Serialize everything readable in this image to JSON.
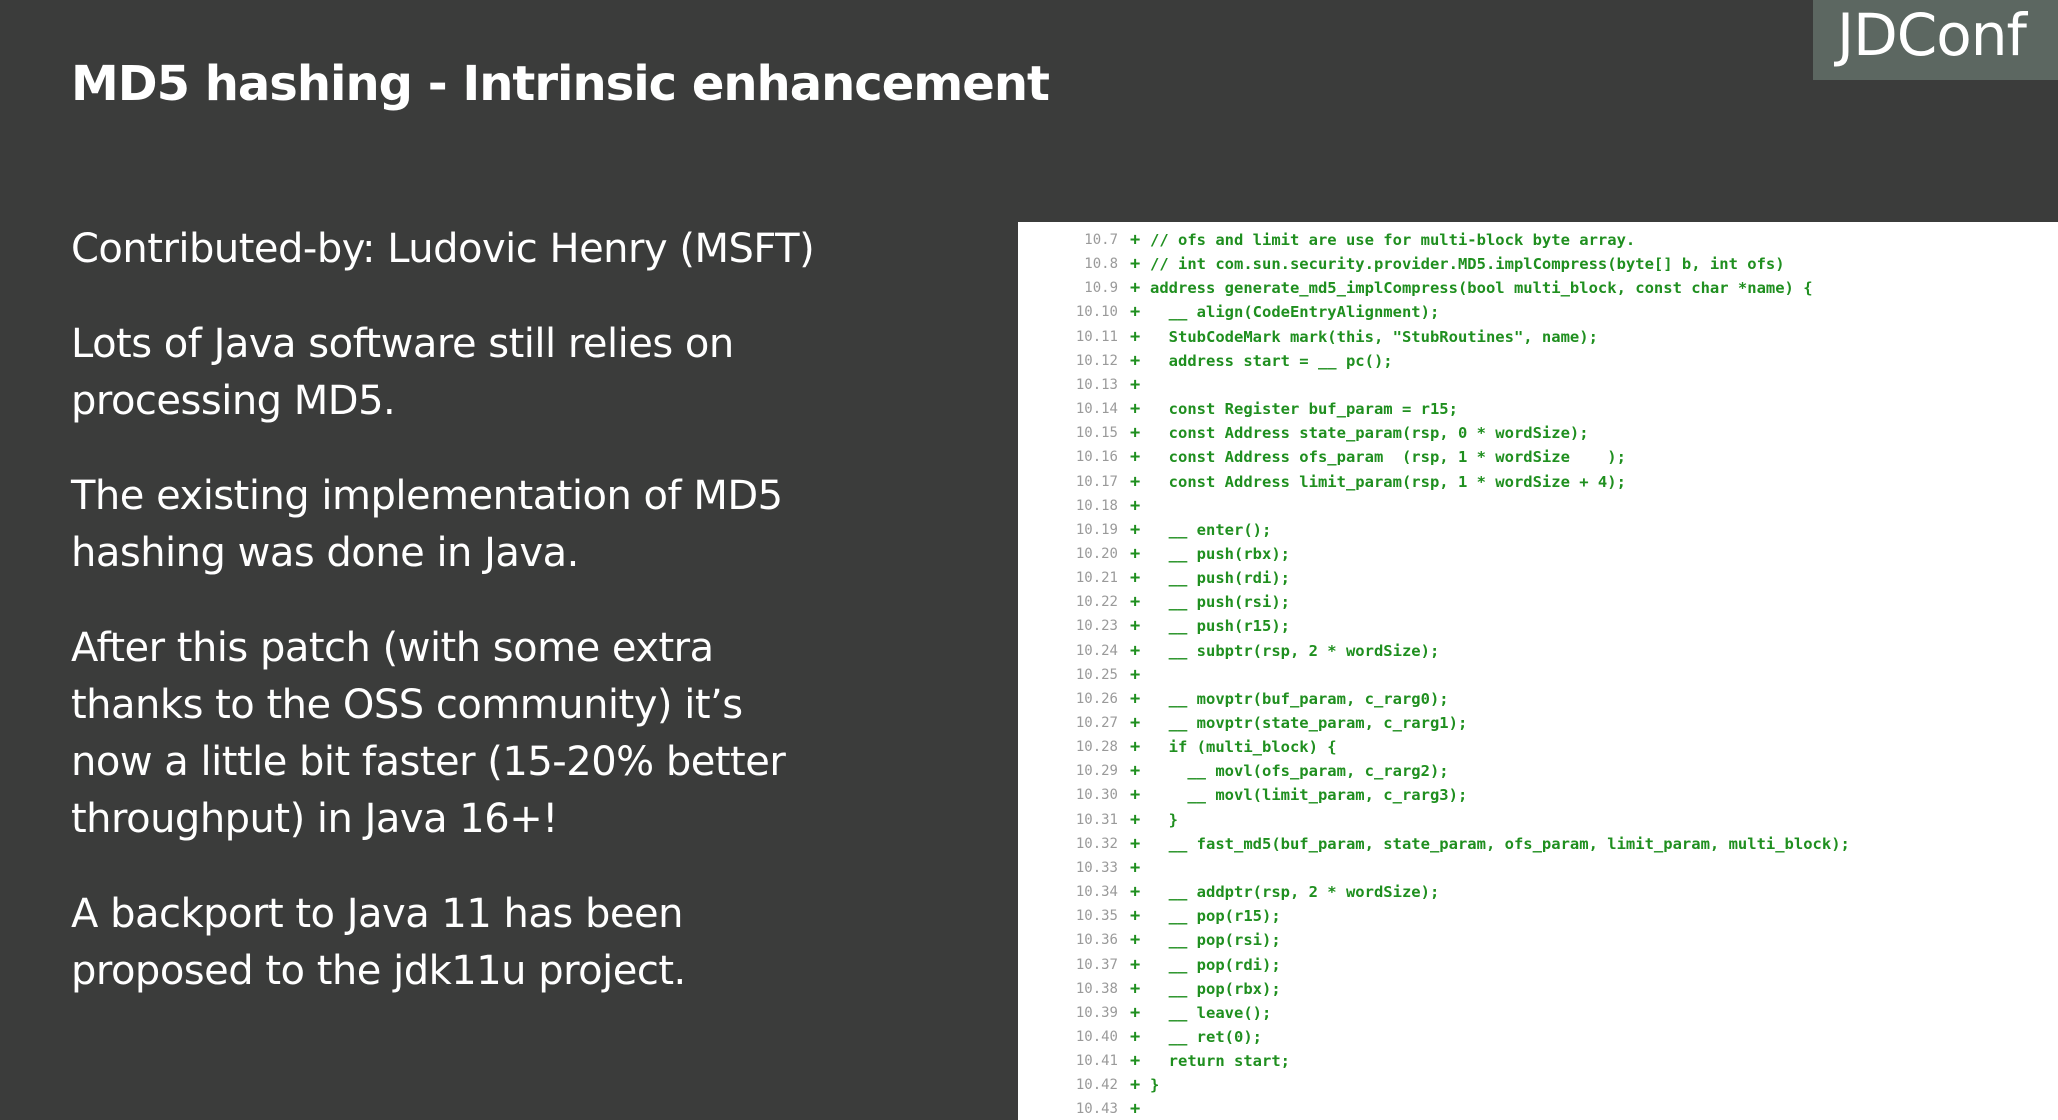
{
  "slide": {
    "title": "MD5 hashing - Intrinsic enhancement",
    "logo": "JDConf",
    "bullets": [
      "Contributed-by: Ludovic Henry (MSFT)",
      "Lots of Java software still relies on\nprocessing MD5.",
      "The existing implementation of MD5\nhashing was done in Java.",
      "After this patch (with some extra\nthanks to the OSS community) it’s\nnow a little bit faster (15-20% better\nthroughput) in Java 16+!",
      "A backport to Java 11 has been\nproposed to the jdk11u project."
    ]
  },
  "code": {
    "lines": [
      {
        "ln": "10.7",
        "mark": "+",
        "text": "// ofs and limit are use for multi-block byte array."
      },
      {
        "ln": "10.8",
        "mark": "+",
        "text": "// int com.sun.security.provider.MD5.implCompress(byte[] b, int ofs)"
      },
      {
        "ln": "10.9",
        "mark": "+",
        "text": "address generate_md5_implCompress(bool multi_block, const char *name) {"
      },
      {
        "ln": "10.10",
        "mark": "+",
        "text": "  __ align(CodeEntryAlignment);"
      },
      {
        "ln": "10.11",
        "mark": "+",
        "text": "  StubCodeMark mark(this, \"StubRoutines\", name);"
      },
      {
        "ln": "10.12",
        "mark": "+",
        "text": "  address start = __ pc();"
      },
      {
        "ln": "10.13",
        "mark": "+",
        "text": ""
      },
      {
        "ln": "10.14",
        "mark": "+",
        "text": "  const Register buf_param = r15;"
      },
      {
        "ln": "10.15",
        "mark": "+",
        "text": "  const Address state_param(rsp, 0 * wordSize);"
      },
      {
        "ln": "10.16",
        "mark": "+",
        "text": "  const Address ofs_param  (rsp, 1 * wordSize    );"
      },
      {
        "ln": "10.17",
        "mark": "+",
        "text": "  const Address limit_param(rsp, 1 * wordSize + 4);"
      },
      {
        "ln": "10.18",
        "mark": "+",
        "text": ""
      },
      {
        "ln": "10.19",
        "mark": "+",
        "text": "  __ enter();"
      },
      {
        "ln": "10.20",
        "mark": "+",
        "text": "  __ push(rbx);"
      },
      {
        "ln": "10.21",
        "mark": "+",
        "text": "  __ push(rdi);"
      },
      {
        "ln": "10.22",
        "mark": "+",
        "text": "  __ push(rsi);"
      },
      {
        "ln": "10.23",
        "mark": "+",
        "text": "  __ push(r15);"
      },
      {
        "ln": "10.24",
        "mark": "+",
        "text": "  __ subptr(rsp, 2 * wordSize);"
      },
      {
        "ln": "10.25",
        "mark": "+",
        "text": ""
      },
      {
        "ln": "10.26",
        "mark": "+",
        "text": "  __ movptr(buf_param, c_rarg0);"
      },
      {
        "ln": "10.27",
        "mark": "+",
        "text": "  __ movptr(state_param, c_rarg1);"
      },
      {
        "ln": "10.28",
        "mark": "+",
        "text": "  if (multi_block) {"
      },
      {
        "ln": "10.29",
        "mark": "+",
        "text": "    __ movl(ofs_param, c_rarg2);"
      },
      {
        "ln": "10.30",
        "mark": "+",
        "text": "    __ movl(limit_param, c_rarg3);"
      },
      {
        "ln": "10.31",
        "mark": "+",
        "text": "  }"
      },
      {
        "ln": "10.32",
        "mark": "+",
        "text": "  __ fast_md5(buf_param, state_param, ofs_param, limit_param, multi_block);"
      },
      {
        "ln": "10.33",
        "mark": "+",
        "text": ""
      },
      {
        "ln": "10.34",
        "mark": "+",
        "text": "  __ addptr(rsp, 2 * wordSize);"
      },
      {
        "ln": "10.35",
        "mark": "+",
        "text": "  __ pop(r15);"
      },
      {
        "ln": "10.36",
        "mark": "+",
        "text": "  __ pop(rsi);"
      },
      {
        "ln": "10.37",
        "mark": "+",
        "text": "  __ pop(rdi);"
      },
      {
        "ln": "10.38",
        "mark": "+",
        "text": "  __ pop(rbx);"
      },
      {
        "ln": "10.39",
        "mark": "+",
        "text": "  __ leave();"
      },
      {
        "ln": "10.40",
        "mark": "+",
        "text": "  __ ret(0);"
      },
      {
        "ln": "10.41",
        "mark": "+",
        "text": "  return start;"
      },
      {
        "ln": "10.42",
        "mark": "+",
        "text": "}"
      },
      {
        "ln": "10.43",
        "mark": "+",
        "text": ""
      }
    ]
  }
}
